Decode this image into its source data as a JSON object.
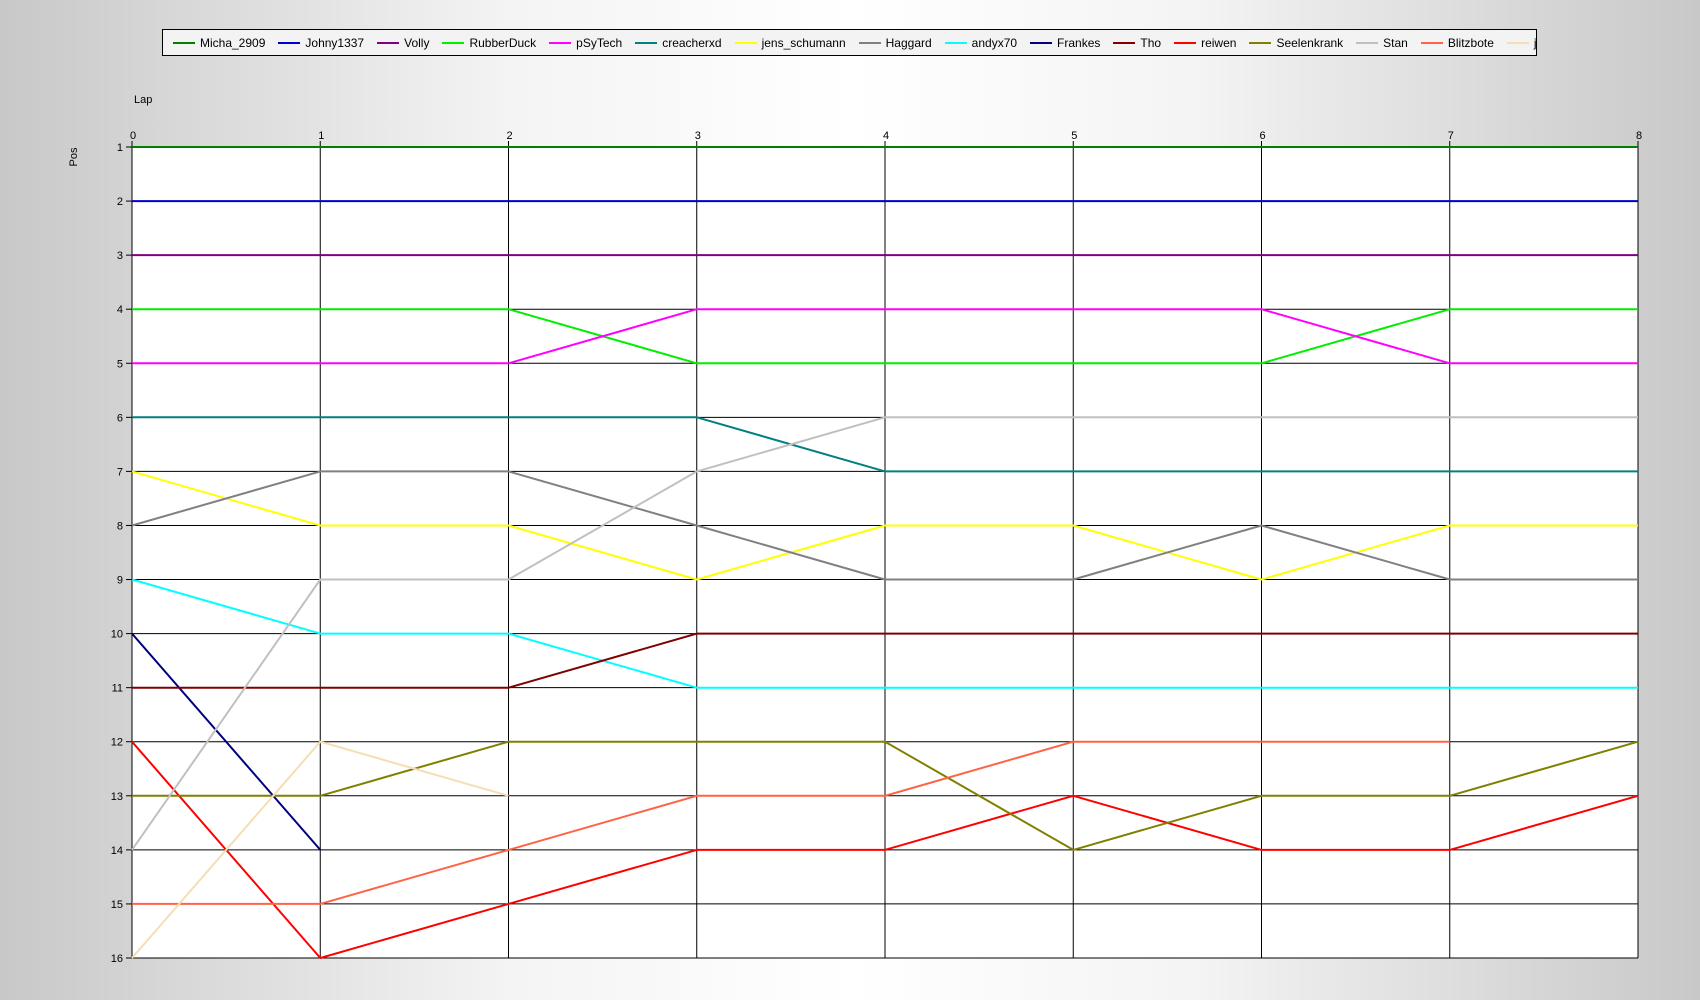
{
  "chart_data": {
    "type": "line",
    "title": "",
    "xlabel": "Lap",
    "ylabel": "Pos",
    "x": [
      0,
      1,
      2,
      3,
      4,
      5,
      6,
      7,
      8
    ],
    "xlim": [
      0,
      8
    ],
    "ylim": [
      1,
      16
    ],
    "y_inverted": true,
    "y_ticks": [
      1,
      2,
      3,
      4,
      5,
      6,
      7,
      8,
      9,
      10,
      11,
      12,
      13,
      14,
      15,
      16
    ],
    "x_ticks": [
      0,
      1,
      2,
      3,
      4,
      5,
      6,
      7,
      8
    ],
    "grid": true,
    "legend_position": "top",
    "series": [
      {
        "name": "Micha_2909",
        "color": "#008000",
        "values": [
          1,
          1,
          1,
          1,
          1,
          1,
          1,
          1,
          1
        ]
      },
      {
        "name": "Johny1337",
        "color": "#0000cd",
        "values": [
          2,
          2,
          2,
          2,
          2,
          2,
          2,
          2,
          2
        ]
      },
      {
        "name": "Volly",
        "color": "#800080",
        "values": [
          3,
          3,
          3,
          3,
          3,
          3,
          3,
          3,
          3
        ]
      },
      {
        "name": "RubberDuck",
        "color": "#00ee00",
        "values": [
          4,
          4,
          4,
          5,
          5,
          5,
          5,
          4,
          4
        ]
      },
      {
        "name": "pSyTech",
        "color": "#ff00ff",
        "values": [
          5,
          5,
          5,
          4,
          4,
          4,
          4,
          5,
          5
        ]
      },
      {
        "name": "creacherxd",
        "color": "#008080",
        "values": [
          6,
          6,
          6,
          6,
          7,
          7,
          7,
          7,
          7
        ]
      },
      {
        "name": "jens_schumann",
        "color": "#ffff00",
        "values": [
          7,
          8,
          8,
          9,
          8,
          8,
          9,
          8,
          8
        ]
      },
      {
        "name": "Haggard",
        "color": "#808080",
        "values": [
          8,
          7,
          7,
          8,
          9,
          9,
          8,
          9,
          9
        ]
      },
      {
        "name": "andyx70",
        "color": "#00ffff",
        "values": [
          9,
          10,
          10,
          11,
          11,
          11,
          11,
          11,
          11
        ]
      },
      {
        "name": "Frankes",
        "color": "#000080",
        "values": [
          10,
          14,
          null,
          null,
          null,
          null,
          null,
          null,
          null
        ]
      },
      {
        "name": "Tho",
        "color": "#800000",
        "values": [
          11,
          11,
          11,
          10,
          10,
          10,
          10,
          10,
          10
        ]
      },
      {
        "name": "reiwen",
        "color": "#ff0000",
        "values": [
          12,
          16,
          15,
          14,
          14,
          13,
          14,
          14,
          13
        ]
      },
      {
        "name": "Seelenkrank",
        "color": "#808000",
        "values": [
          13,
          13,
          12,
          12,
          12,
          14,
          13,
          13,
          12
        ]
      },
      {
        "name": "Stan",
        "color": "#c0c0c0",
        "values": [
          14,
          9,
          9,
          7,
          6,
          6,
          6,
          6,
          6
        ]
      },
      {
        "name": "Blitzbote",
        "color": "#ff6347",
        "values": [
          15,
          15,
          14,
          13,
          13,
          12,
          12,
          12,
          null
        ]
      },
      {
        "name": "jerzem",
        "color": "#f5deb3",
        "values": [
          16,
          12,
          13,
          null,
          null,
          null,
          null,
          null,
          null
        ]
      }
    ]
  }
}
